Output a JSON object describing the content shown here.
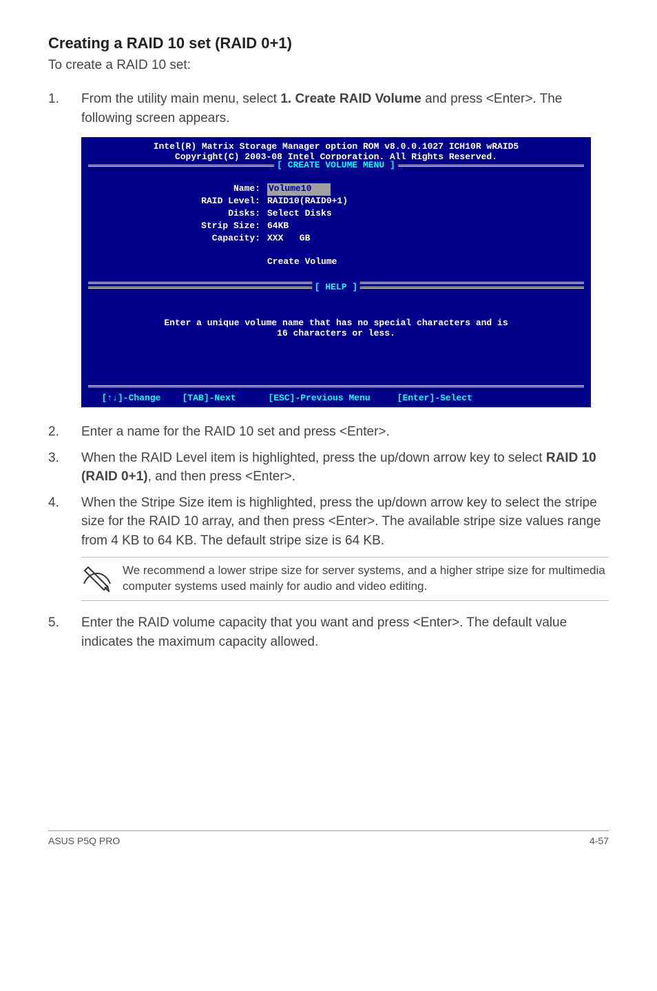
{
  "section": {
    "title": "Creating a RAID 10 set (RAID 0+1)",
    "intro": "To create a RAID 10 set:"
  },
  "steps": {
    "s1": {
      "num": "1.",
      "part1": "From the utility main menu, select ",
      "bold": "1. Create RAID Volume",
      "part2": " and press <Enter>. The following screen appears."
    },
    "s2": {
      "num": "2.",
      "text": "Enter a name for the RAID 10 set and press <Enter>."
    },
    "s3": {
      "num": "3.",
      "part1": "When the RAID Level item is highlighted, press the up/down arrow key to select ",
      "bold": "RAID 10 (RAID 0+1)",
      "part2": ", and then press <Enter>."
    },
    "s4": {
      "num": "4.",
      "text": "When the Stripe Size item is highlighted, press the up/down arrow key to select the stripe size for the RAID 10 array, and then press <Enter>. The available stripe size values range from 4 KB to 64 KB. The default stripe size is 64 KB."
    },
    "s5": {
      "num": "5.",
      "text": "Enter the RAID volume capacity that you want and press <Enter>. The default value indicates the maximum capacity allowed."
    }
  },
  "note": {
    "text": "We recommend a lower stripe size for server systems, and a higher stripe size for multimedia computer systems used mainly for audio and video editing."
  },
  "bios": {
    "header1": "Intel(R) Matrix Storage Manager option ROM v8.0.0.1027 ICH10R wRAID5",
    "header2": "Copyright(C) 2003-08 Intel Corporation. All Rights Reserved.",
    "menu_title": "[ CREATE VOLUME MENU ]",
    "fields": {
      "name_label": "Name:",
      "name_value": "Volume10   ",
      "raid_label": "RAID Level:",
      "raid_value": "RAID10(RAID0+1)",
      "disks_label": "Disks:",
      "disks_value": "Select Disks",
      "strip_label": "Strip Size:",
      "strip_value": "64KB",
      "capacity_label": "Capacity:",
      "capacity_value": "XXX   GB"
    },
    "create_volume": "Create Volume",
    "help_title": "[ HELP ]",
    "help_line1": "Enter a unique volume name that has no special characters and is",
    "help_line2": "16 characters or less.",
    "footer": "  [↑↓]-Change    [TAB]-Next      [ESC]-Previous Menu     [Enter]-Select"
  },
  "page_footer": {
    "left": "ASUS P5Q PRO",
    "right": "4-57"
  }
}
